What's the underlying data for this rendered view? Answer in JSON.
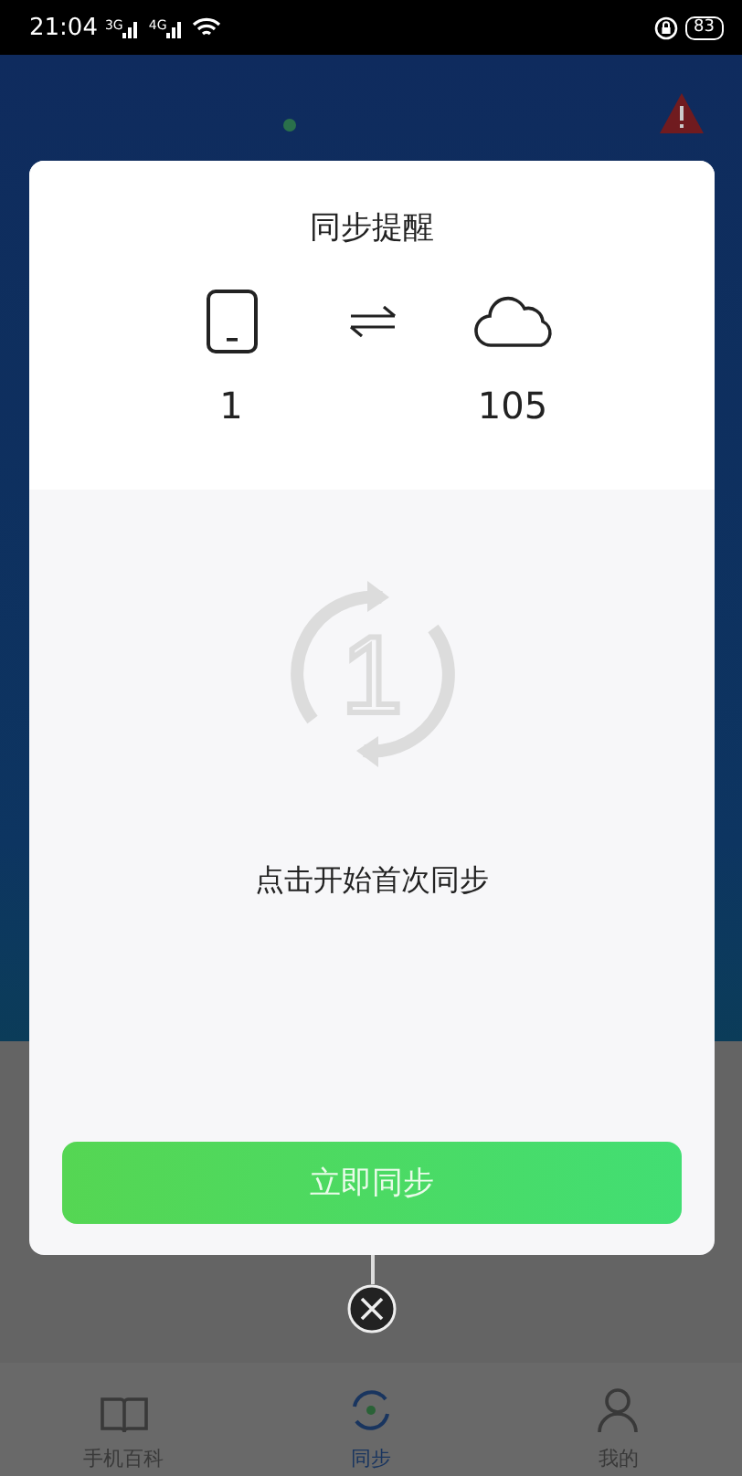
{
  "status_bar": {
    "time": "21:04",
    "signal_labels": [
      "3G",
      "4G"
    ],
    "battery": "83"
  },
  "dialog": {
    "title": "同步提醒",
    "local_count": "1",
    "cloud_count": "105",
    "badge": "1",
    "message": "点击开始首次同步",
    "button": "立即同步"
  },
  "bottom_nav": [
    {
      "label": "手机百科",
      "kind": "book",
      "selected": false
    },
    {
      "label": "同步",
      "kind": "sync",
      "selected": true
    },
    {
      "label": "我的",
      "kind": "person",
      "selected": false
    }
  ]
}
